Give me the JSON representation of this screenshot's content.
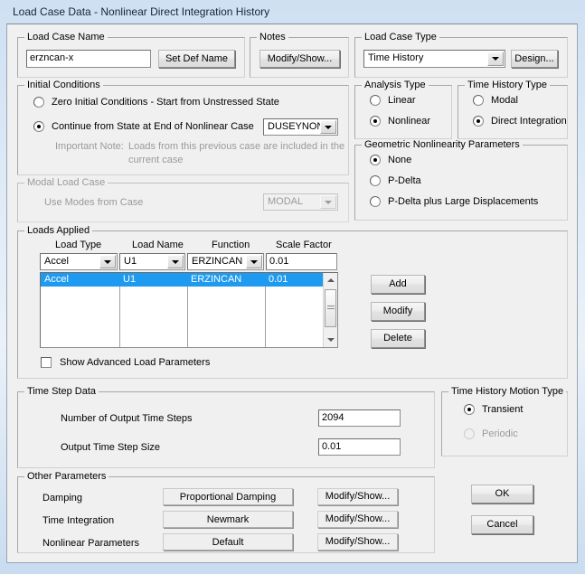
{
  "window": {
    "title": "Load Case Data - Nonlinear Direct Integration History"
  },
  "load_case_name": {
    "group_label": "Load Case Name",
    "value": "erzncan-x",
    "set_def_name_button": "Set Def Name"
  },
  "notes": {
    "group_label": "Notes",
    "modify_show_button": "Modify/Show..."
  },
  "load_case_type": {
    "group_label": "Load Case Type",
    "selected": "Time History",
    "design_button": "Design..."
  },
  "initial_conditions": {
    "group_label": "Initial Conditions",
    "option_zero": "Zero Initial Conditions - Start from Unstressed State",
    "option_continue": "Continue from State at End of Nonlinear Case",
    "continue_case": "DUSEYNON",
    "note_label": "Important Note:",
    "note_line1": "Loads from this previous case are included in the",
    "note_line2": "current case",
    "selected": "continue"
  },
  "analysis_type": {
    "group_label": "Analysis Type",
    "option_linear": "Linear",
    "option_nonlinear": "Nonlinear",
    "selected": "nonlinear"
  },
  "time_history_type": {
    "group_label": "Time History Type",
    "option_modal": "Modal",
    "option_direct": "Direct Integration",
    "selected": "direct"
  },
  "geometric_nonlinearity": {
    "group_label": "Geometric Nonlinearity Parameters",
    "option_none": "None",
    "option_pdelta": "P-Delta",
    "option_pdelta_large": "P-Delta plus Large Displacements",
    "selected": "none"
  },
  "modal_load_case": {
    "group_label": "Modal Load Case",
    "use_modes_label": "Use Modes from Case",
    "selected": "MODAL",
    "disabled": true
  },
  "loads_applied": {
    "group_label": "Loads Applied",
    "headers": [
      "Load Type",
      "Load Name",
      "Function",
      "Scale Factor"
    ],
    "editor": {
      "load_type": "Accel",
      "load_name": "U1",
      "function": "ERZINCAN",
      "scale_factor": "0.01"
    },
    "rows": [
      {
        "load_type": "Accel",
        "load_name": "U1",
        "function": "ERZINCAN",
        "scale_factor": "0.01",
        "selected": true
      }
    ],
    "buttons": {
      "add": "Add",
      "modify": "Modify",
      "delete": "Delete"
    },
    "show_advanced_checkbox": "Show Advanced Load Parameters",
    "show_advanced_checked": false
  },
  "time_step_data": {
    "group_label": "Time Step Data",
    "number_of_steps_label": "Number of Output Time Steps",
    "number_of_steps_value": "2094",
    "step_size_label": "Output Time Step Size",
    "step_size_value": "0.01"
  },
  "motion_type": {
    "group_label": "Time History Motion Type",
    "option_transient": "Transient",
    "option_periodic": "Periodic",
    "selected": "transient",
    "periodic_disabled": true
  },
  "other_parameters": {
    "group_label": "Other Parameters",
    "rows": [
      {
        "label": "Damping",
        "value": "Proportional Damping",
        "button": "Modify/Show..."
      },
      {
        "label": "Time Integration",
        "value": "Newmark",
        "button": "Modify/Show..."
      },
      {
        "label": "Nonlinear Parameters",
        "value": "Default",
        "button": "Modify/Show..."
      }
    ]
  },
  "dialog_buttons": {
    "ok": "OK",
    "cancel": "Cancel"
  },
  "colors": {
    "selection_blue": "#1e9bf0",
    "dialog_face": "#f0f0f0",
    "disabled_text": "#9a9a9a"
  }
}
